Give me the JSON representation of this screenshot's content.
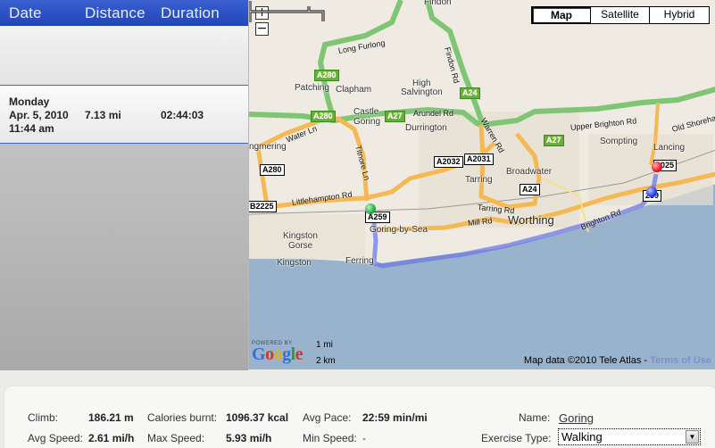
{
  "list": {
    "headers": {
      "date": "Date",
      "distance": "Distance",
      "duration": "Duration"
    },
    "rows": [
      {
        "day": "Monday",
        "date": "Apr. 5, 2010",
        "time": "11:44 am",
        "distance": "7.13 mi",
        "duration": "02:44:03"
      }
    ]
  },
  "map": {
    "zoom_in": "+",
    "zoom_out": "−",
    "map_types": [
      "Map",
      "Satellite",
      "Hybrid"
    ],
    "active_map_type": "Map",
    "places": {
      "findon": "Findon",
      "patching": "Patching",
      "clapham": "Clapham",
      "high": "High",
      "salvington": "Salvington",
      "castle": "Castle",
      "goring": "Goring",
      "durrington": "Durrington",
      "angmering": "ngmering",
      "tarring": "Tarring",
      "broadwater": "Broadwater",
      "sompting": "Sompting",
      "lancing": "Lancing",
      "worthing": "Worthing",
      "goring_by_sea": "Goring-by-Sea",
      "kingston_gorse_1": "Kingston",
      "kingston_gorse_2": "Gorse",
      "kingston": "Kingston",
      "ferring": "Ferring"
    },
    "roads": {
      "long_furlong": "Long Furlong",
      "findon_rd": "Findon Rd",
      "arundel_rd": "Arundel Rd",
      "warren_rd": "Warren Rd",
      "upper_brighton_rd": "Upper Brighton Rd",
      "old_shoreham": "Old Shoreham",
      "water_ln": "Water Ln",
      "titnore_ln": "Titnore Ln",
      "littlehampton_rd": "Littlehampton Rd",
      "tarring_rd": "Tarring Rd",
      "mill_rd": "Mill Rd",
      "brighton_rd": "Brighton Rd"
    },
    "shields": {
      "a280_1": "A280",
      "a280_2": "A280",
      "a24_1": "A24",
      "a27_1": "A27",
      "a27_2": "A27",
      "a280_white": "A280",
      "b2225": "B2225",
      "a259_1": "A259",
      "a2032": "A2032",
      "a2031": "A2031",
      "a24_2": "A24",
      "a2025": "2025",
      "a259_2": "259"
    },
    "powered_by": "POWERED BY",
    "scale_mi": "1 mi",
    "scale_km": "2 km",
    "copyright": "Map data ©2010 Tele Atlas - ",
    "terms": "Terms of Use"
  },
  "stats": {
    "climb_label": "Climb:",
    "climb": "186.21 m",
    "calories_label": "Calories burnt:",
    "calories": "1096.37 kcal",
    "avg_pace_label": "Avg Pace:",
    "avg_pace": "22:59 min/mi",
    "avg_speed_label": "Avg Speed:",
    "avg_speed": "2.61 mi/h",
    "max_speed_label": "Max Speed:",
    "max_speed": "5.93 mi/h",
    "min_speed_label": "Min Speed:",
    "min_speed": "-",
    "name_label": "Name:",
    "name": "Goring",
    "exercise_type_label": "Exercise Type:",
    "exercise_type": "Walking"
  }
}
